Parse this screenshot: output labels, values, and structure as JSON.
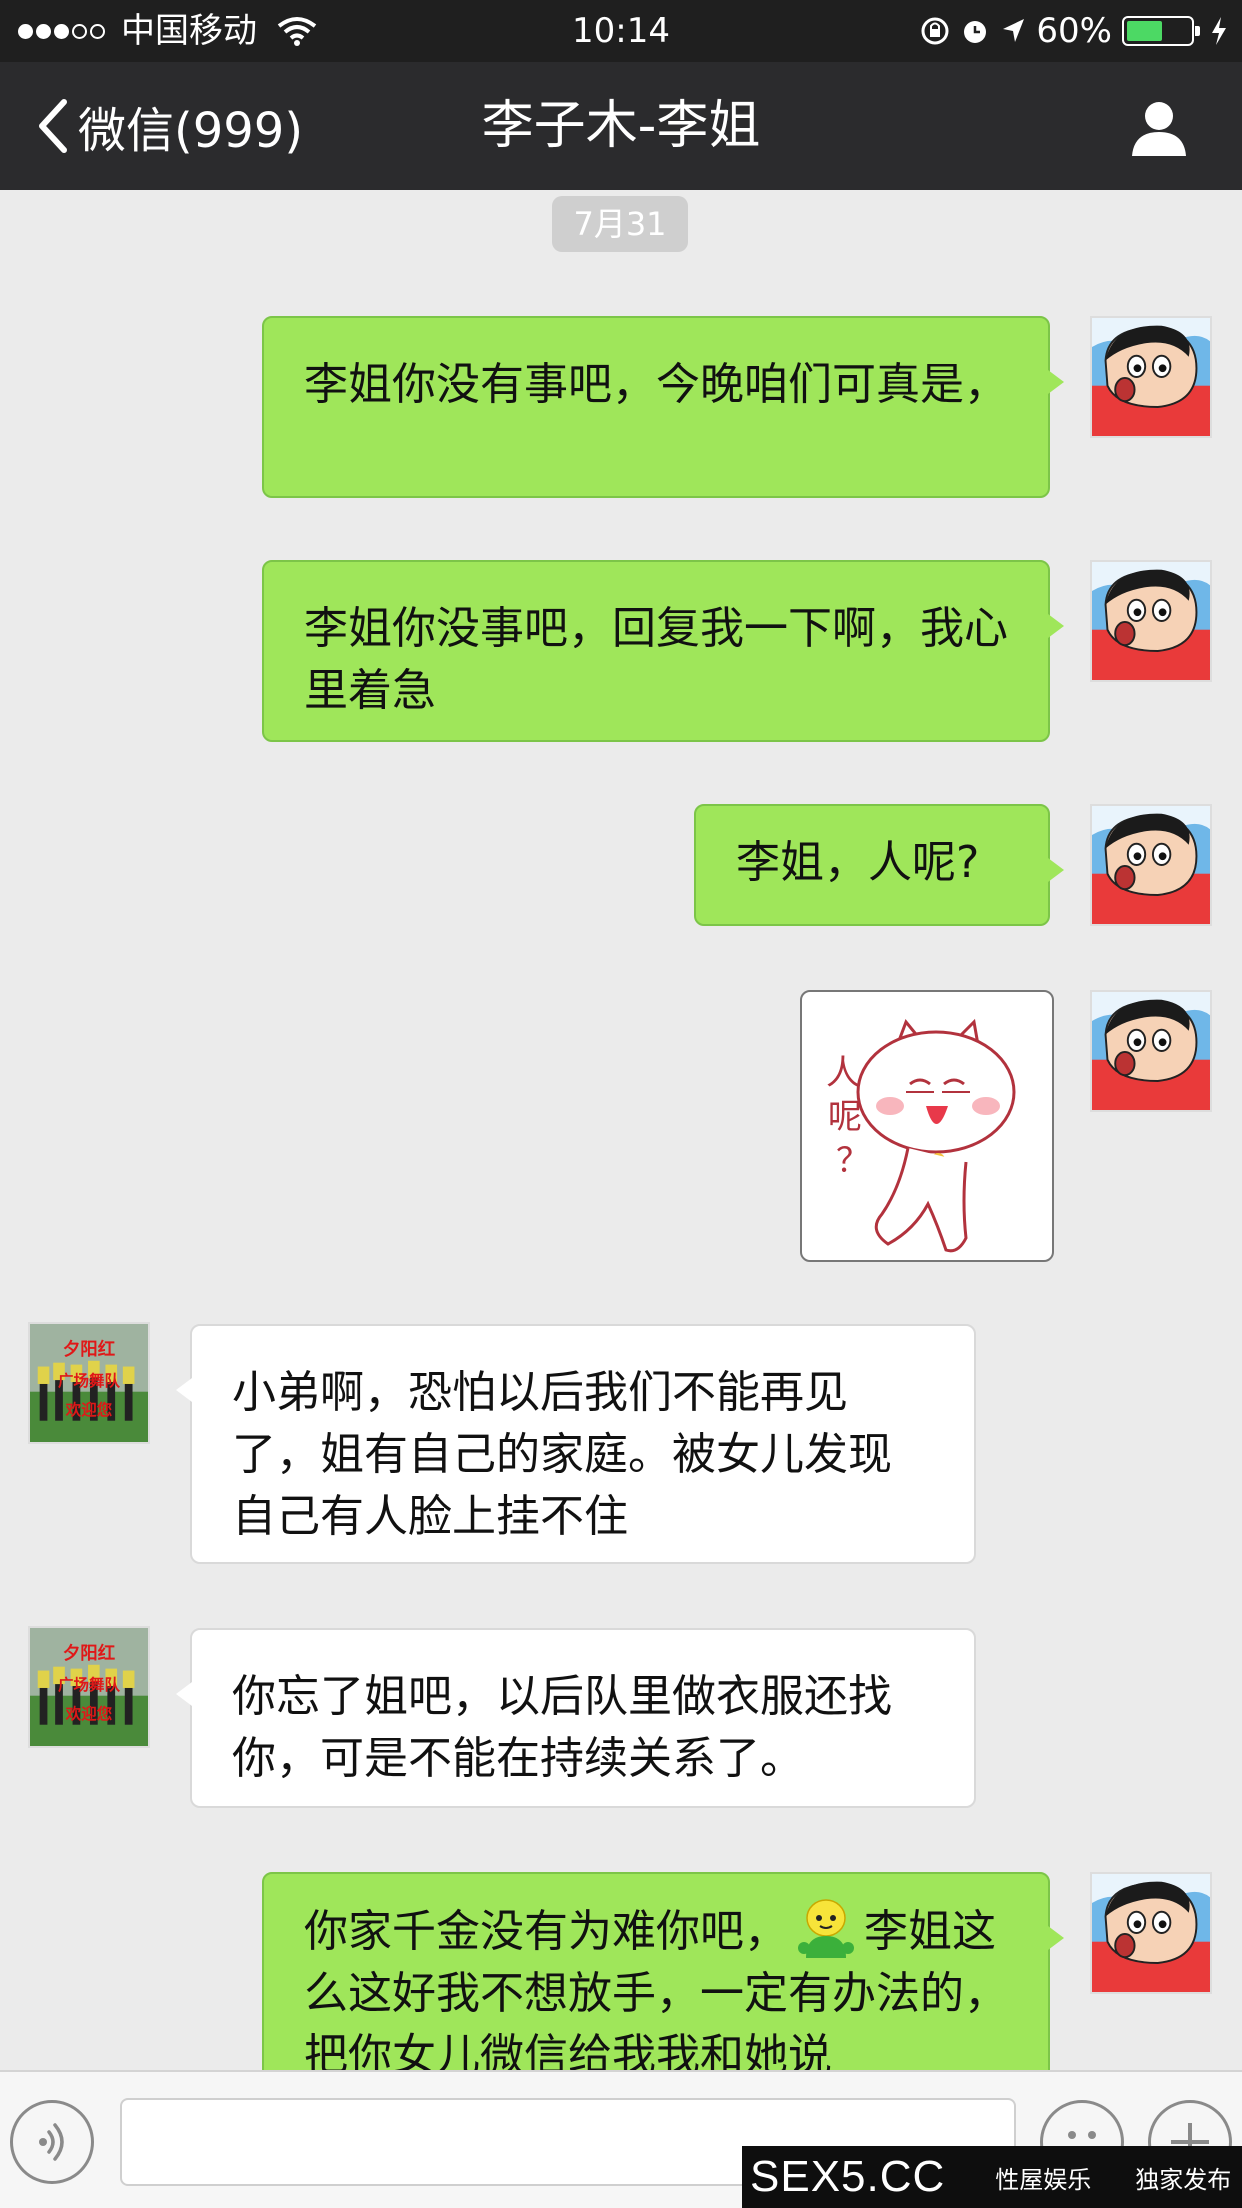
{
  "status_bar": {
    "carrier": "中国移动",
    "time": "10:14",
    "battery": "60%",
    "battery_level": 0.6,
    "icons": [
      "signal-dots",
      "wifi-icon",
      "orientation-lock-icon",
      "alarm-icon",
      "location-icon",
      "battery-icon",
      "charging-icon"
    ]
  },
  "nav": {
    "back_label": "微信(999)",
    "title": "李子木-李姐",
    "profile_icon": "person-icon"
  },
  "chat": {
    "date": "7月31",
    "messages": [
      {
        "side": "me",
        "text": "李姐你没有事吧，今晚咱们可真是，"
      },
      {
        "side": "me",
        "text": "李姐你没事吧，回复我一下啊，我心里着急"
      },
      {
        "side": "me",
        "text": "李姐，人呢?"
      },
      {
        "side": "me",
        "type": "sticker",
        "sticker_text": "人呢？"
      },
      {
        "side": "them",
        "text": "小弟啊，恐怕以后我们不能再见了，姐有自己的家庭。被女儿发现自己有人脸上挂不住"
      },
      {
        "side": "them",
        "text": "你忘了姐吧，以后队里做衣服还找你，可是不能在持续关系了。"
      },
      {
        "side": "me",
        "text_before_emoji": "你家千金没有为难你吧，",
        "text_after_emoji": "李姐这么这好我不想放手，一定有办法的，把你女儿微信给我我和她说"
      }
    ],
    "them_avatar_text": [
      "夕阳红",
      "广场舞队",
      "欢迎您"
    ]
  },
  "input_bar": {
    "voice_icon": "voice-icon",
    "emoji_icon": "emoji-icon",
    "plus_icon": "plus-icon"
  },
  "watermark": {
    "logo": "SEX5.CC",
    "tag1": "性屋娱乐",
    "tag2": "独家发布"
  },
  "colors": {
    "my_bubble": "#9fe65a",
    "their_bubble": "#ffffff",
    "nav_bg": "#2b2b2d",
    "chat_bg": "#ebebeb"
  }
}
